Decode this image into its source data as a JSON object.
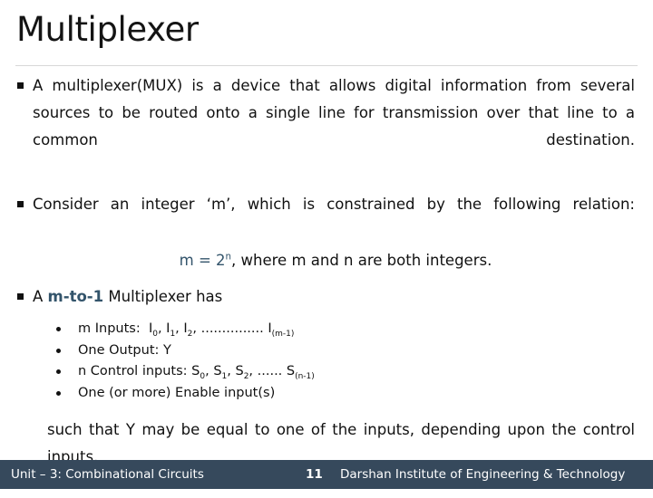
{
  "slide": {
    "title": "Multiplexer",
    "bullets": [
      {
        "marker": "square-bullet",
        "text": "A multiplexer(MUX) is a device that allows digital information from several sources to be routed onto a single line for transmission over that line to a common destination."
      },
      {
        "marker": "square-bullet",
        "text": "Consider an integer ‘m’, which is constrained by the following relation:"
      }
    ],
    "equation": {
      "lhs": "m = 2",
      "exponent": "n",
      "rest": ", where m and n are both integers.",
      "accent_color": "#33546B"
    },
    "bullet3": {
      "marker": "square-bullet",
      "prefix": "A ",
      "highlight": "m-to-1",
      "suffix": " Multiplexer has"
    },
    "sub_bullets": [
      {
        "marker": "round-bullet",
        "label": "m Inputs:",
        "items": "I",
        "sub1": "0",
        "sep1": ", I",
        "sub2": "1",
        "sep2": ", I",
        "sub3": "2",
        "dots": ", ............... I",
        "sub4": "(m-1)",
        "full_text": "m Inputs:  I0, I1, I2, ............... I(m-1)"
      },
      {
        "marker": "round-bullet",
        "full_text": "One Output: Y"
      },
      {
        "marker": "round-bullet",
        "label": "n Control inputs:",
        "items": "S",
        "sub1": "0",
        "sep1": ", S",
        "sub2": "1",
        "sep2": ", S",
        "sub3": "2",
        "dots": ", ...... S",
        "sub4": "(n-1)",
        "full_text": "n Control inputs: S0, S1, S2, ...... S(n-1)"
      },
      {
        "marker": "round-bullet",
        "full_text": "One (or more) Enable input(s)"
      }
    ],
    "closing_paragraph": "such that Y may be equal to one of the inputs, depending upon the control inputs."
  },
  "footer": {
    "unit": "Unit – 3: Combinational Circuits",
    "page_number": "11",
    "institute": "Darshan Institute of Engineering & Technology",
    "background_color": "#36495C",
    "text_color": "#FFFFFF"
  }
}
